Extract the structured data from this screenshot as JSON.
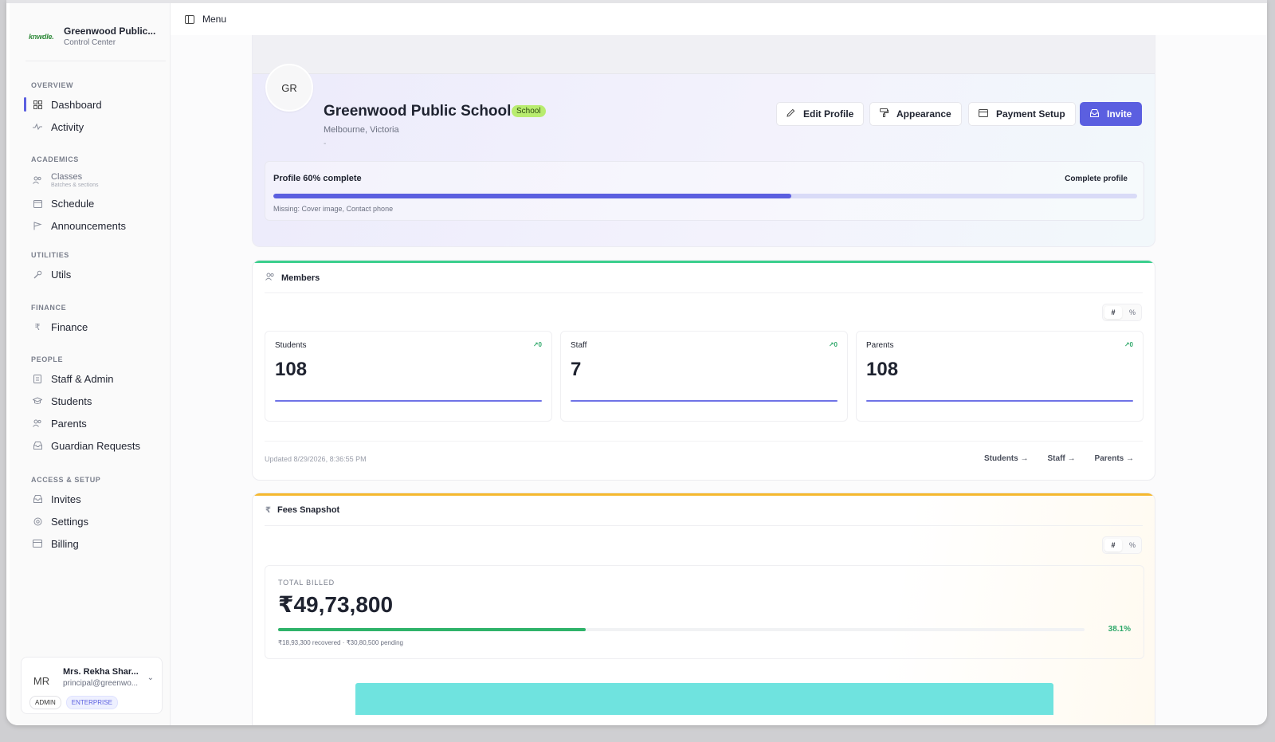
{
  "brand": {
    "logo": "knwdle.",
    "name": "Greenwood Public...",
    "sub": "Control Center"
  },
  "sidebar": {
    "sections": {
      "overview": "OVERVIEW",
      "academics": "ACADEMICS",
      "utilities": "UTILITIES",
      "finance": "FINANCE",
      "people": "PEOPLE",
      "access": "ACCESS & SETUP"
    },
    "items": {
      "dashboard": "Dashboard",
      "activity": "Activity",
      "classes": "Classes",
      "classes_sub": "Batches & sections",
      "schedule": "Schedule",
      "announcements": "Announcements",
      "utils": "Utils",
      "finance": "Finance",
      "staff_admin": "Staff & Admin",
      "students": "Students",
      "parents": "Parents",
      "guardian_requests": "Guardian Requests",
      "invites": "Invites",
      "settings": "Settings",
      "billing": "Billing"
    }
  },
  "user": {
    "initials": "MR",
    "name": "Mrs. Rekha Shar...",
    "email": "principal@greenwo...",
    "role": "ADMIN",
    "plan": "ENTERPRISE"
  },
  "topbar": {
    "menu_label": "Menu"
  },
  "profile": {
    "initials": "GR",
    "name": "Greenwood Public School",
    "tag": "School",
    "location": "Melbourne, Victoria",
    "extra": "-",
    "buttons": {
      "edit": "Edit Profile",
      "appearance": "Appearance",
      "payment": "Payment Setup",
      "invite": "Invite"
    },
    "completion": {
      "label": "Profile 60% complete",
      "percent": 60,
      "link": "Complete profile",
      "missing": "Missing: Cover image, Contact phone"
    }
  },
  "members": {
    "title": "Members",
    "toggle": [
      "#",
      "%"
    ],
    "stats": [
      {
        "label": "Students",
        "trend": "0",
        "value": "108"
      },
      {
        "label": "Staff",
        "trend": "0",
        "value": "7"
      },
      {
        "label": "Parents",
        "trend": "0",
        "value": "108"
      }
    ],
    "updated": "Updated 8/29/2026, 8:36:55 PM",
    "links": [
      "Students",
      "Staff",
      "Parents"
    ]
  },
  "fees": {
    "title": "Fees Snapshot",
    "toggle": [
      "#",
      "%"
    ],
    "total_label": "TOTAL BILLED",
    "total_value": "₹49,73,800",
    "percent_text": "38.1%",
    "percent": 38.1,
    "sub": "₹18,93,300 recovered · ₹30,80,500 pending"
  },
  "colors": {
    "accent": "#5b5fe0",
    "members_accent": "#3ccf8e",
    "fees_accent": "#f5b82e",
    "success": "#2fb36a"
  }
}
